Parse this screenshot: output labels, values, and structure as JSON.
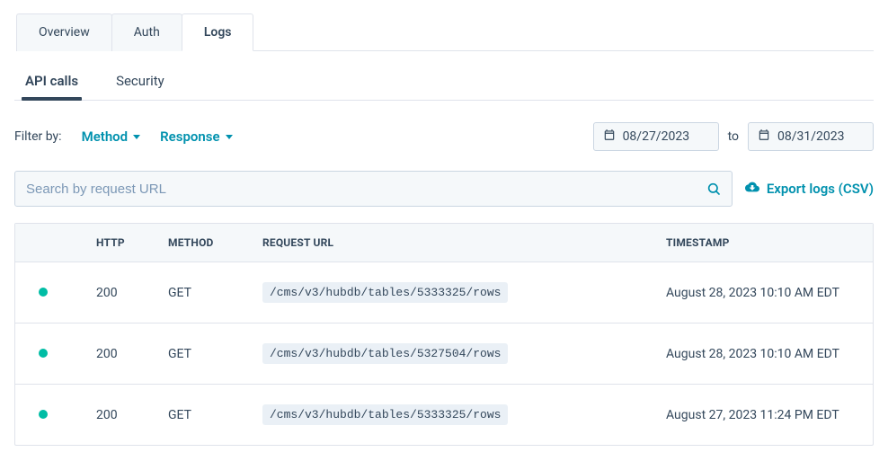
{
  "tabs_top": [
    {
      "label": "Overview",
      "active": false
    },
    {
      "label": "Auth",
      "active": false
    },
    {
      "label": "Logs",
      "active": true
    }
  ],
  "tabs_sub": [
    {
      "label": "API calls",
      "active": true
    },
    {
      "label": "Security",
      "active": false
    }
  ],
  "filter": {
    "label": "Filter by:",
    "method_label": "Method",
    "response_label": "Response"
  },
  "date": {
    "from": "08/27/2023",
    "to_label": "to",
    "to": "08/31/2023"
  },
  "search": {
    "placeholder": "Search by request URL"
  },
  "export_label": "Export logs (CSV)",
  "table": {
    "headers": {
      "http": "HTTP",
      "method": "METHOD",
      "url": "REQUEST URL",
      "timestamp": "TIMESTAMP"
    },
    "rows": [
      {
        "http": "200",
        "method": "GET",
        "url": "/cms/v3/hubdb/tables/5333325/rows",
        "timestamp": "August 28, 2023 10:10 AM EDT"
      },
      {
        "http": "200",
        "method": "GET",
        "url": "/cms/v3/hubdb/tables/5327504/rows",
        "timestamp": "August 28, 2023 10:10 AM EDT"
      },
      {
        "http": "200",
        "method": "GET",
        "url": "/cms/v3/hubdb/tables/5333325/rows",
        "timestamp": "August 27, 2023 11:24 PM EDT"
      }
    ]
  },
  "colors": {
    "accent": "#0091ae",
    "status_ok": "#00bda5"
  }
}
